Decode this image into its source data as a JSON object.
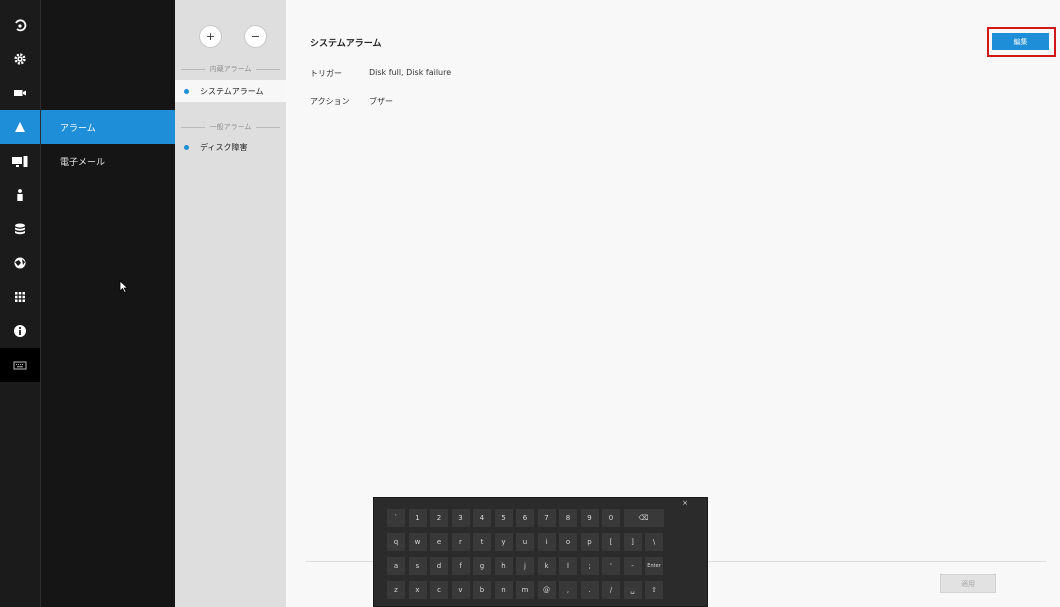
{
  "rail": {
    "items": [
      {
        "icon": "playback-icon",
        "active": false
      },
      {
        "icon": "gear-icon",
        "active": false
      },
      {
        "icon": "camera-icon",
        "active": false
      },
      {
        "icon": "alarm-icon",
        "active": true
      },
      {
        "icon": "monitor-icon",
        "active": false
      },
      {
        "icon": "user-icon",
        "active": false
      },
      {
        "icon": "storage-icon",
        "active": false
      },
      {
        "icon": "network-icon",
        "active": false
      },
      {
        "icon": "apps-grid-icon",
        "active": false
      },
      {
        "icon": "info-icon",
        "active": false
      },
      {
        "icon": "keyboard-icon",
        "active": false
      }
    ]
  },
  "subnav": {
    "items": [
      {
        "label": "アラーム",
        "active": true
      },
      {
        "label": "電子メール",
        "active": false
      }
    ]
  },
  "list": {
    "add_label": "+",
    "remove_label": "−",
    "builtin_section": "内蔵アラーム",
    "builtin_items": [
      "システムアラーム"
    ],
    "general_section": "一般アラーム",
    "general_items": [
      "ディスク障害"
    ]
  },
  "main": {
    "title": "システムアラーム",
    "trigger_label": "トリガー",
    "trigger_value": "Disk full, Disk failure",
    "action_label": "アクション",
    "action_value": "ブザー",
    "edit_label": "編集",
    "apply_label": "適用"
  },
  "keyboard": {
    "close_label": "×",
    "rows": [
      [
        "`",
        "1",
        "2",
        "3",
        "4",
        "5",
        "6",
        "7",
        "8",
        "9",
        "0",
        "⌫"
      ],
      [
        "q",
        "w",
        "e",
        "r",
        "t",
        "y",
        "u",
        "i",
        "o",
        "p",
        "[",
        "]",
        "\\"
      ],
      [
        "a",
        "s",
        "d",
        "f",
        "g",
        "h",
        "j",
        "k",
        "l",
        ";",
        "'",
        "-",
        "Enter"
      ],
      [
        "z",
        "x",
        "c",
        "v",
        "b",
        "n",
        "m",
        "@",
        ",",
        ".",
        "/",
        "␣",
        "⇧"
      ]
    ]
  },
  "colors": {
    "accent": "#1f8ed8",
    "rail_bg": "#1b1b1b",
    "subnav_bg": "#151515",
    "list_bg": "#dedede",
    "highlight": "#d01818"
  }
}
